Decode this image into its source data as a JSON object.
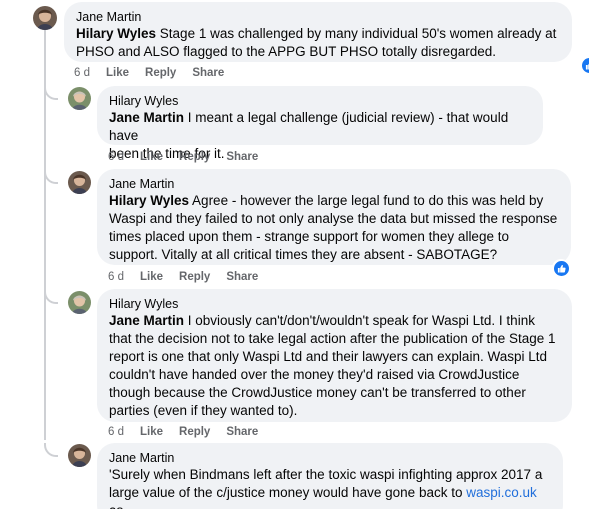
{
  "comments": [
    {
      "author": "Jane Martin",
      "mention": "Hilary Wyles",
      "lines": [
        " Stage 1 was challenged by many individual 50's women already at",
        "PHSO and ALSO flagged to the APPG BUT PHSO totally disregarded."
      ],
      "age": "6 d",
      "actions": [
        "Like",
        "Reply",
        "Share"
      ]
    },
    {
      "author": "Hilary Wyles",
      "mention": "Jane Martin",
      "lines": [
        " I meant a legal challenge (judicial review) - that would have",
        "been the time for it."
      ],
      "age": "6 d",
      "actions": [
        "Like",
        "Reply",
        "Share"
      ]
    },
    {
      "author": "Jane Martin",
      "mention": "Hilary Wyles",
      "lines": [
        " Agree - however the large legal fund to do this was held by",
        "Waspi and they failed to not only analyse the data but missed the response",
        "times placed upon them - strange support for women they allege to",
        "support. Vitally at all critical times they are absent - SABOTAGE?"
      ],
      "age": "6 d",
      "actions": [
        "Like",
        "Reply",
        "Share"
      ]
    },
    {
      "author": "Hilary Wyles",
      "mention": "Jane Martin",
      "lines": [
        " I obviously can't/don't/wouldn't speak for Waspi Ltd. I think",
        "that the decision not to take legal action after the publication of the Stage 1",
        "report is one that only Waspi Ltd and their lawyers can explain. Waspi Ltd",
        "couldn't have handed over the money they'd raised via CrowdJustice",
        "though because the CrowdJustice money can't be transferred to other",
        "parties (even if they wanted to)."
      ],
      "age": "6 d",
      "actions": [
        "Like",
        "Reply",
        "Share"
      ]
    },
    {
      "author": "Jane Martin",
      "lines": [
        "'Surely when Bindmans left after the toxic waspi infighting approx 2017 a"
      ],
      "last_line_before": "large value of the c/justice money would have gone back to ",
      "last_line_link": "waspi.co.uk",
      "last_line_after": " as"
    }
  ],
  "colors": {
    "bubble": "#f0f2f5",
    "text": "#050505",
    "meta": "#65676b",
    "link": "#216fdb",
    "like_badge": "#1877f2",
    "thread_line": "#ced0d4"
  },
  "icons": {
    "like_badge": "thumbs-up-icon"
  }
}
